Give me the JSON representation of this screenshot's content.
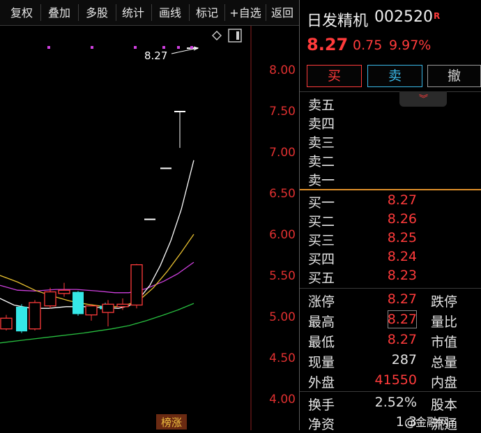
{
  "toolbar": {
    "items": [
      {
        "label": "复权"
      },
      {
        "label": "叠加"
      },
      {
        "label": "多股"
      },
      {
        "label": "统计"
      },
      {
        "label": "画线"
      },
      {
        "label": "标记"
      },
      {
        "label": "+自选"
      },
      {
        "label": "返回"
      }
    ]
  },
  "chart": {
    "price_ticks": [
      "8.00",
      "7.50",
      "7.00",
      "6.50",
      "6.00",
      "5.50",
      "5.00",
      "4.50",
      "4.00"
    ],
    "last_price_label": "8.27",
    "badge": "榜涨",
    "colors": {
      "up": "#ff3b3b",
      "down": "#35e6e6",
      "ma_white": "#ffffff",
      "ma_yellow": "#e8c030",
      "ma_magenta": "#d040e0",
      "ma_green": "#28c040"
    }
  },
  "chart_data": {
    "type": "candlestick",
    "y_axis_ticks": [
      8.0,
      7.5,
      7.0,
      6.5,
      6.0,
      5.5,
      5.0,
      4.5,
      4.0
    ],
    "ylim": [
      3.8,
      8.4
    ],
    "candles": [
      {
        "open": 4.85,
        "close": 4.98,
        "high": 5.02,
        "low": 4.83,
        "dir": "up"
      },
      {
        "open": 5.12,
        "close": 4.82,
        "high": 5.15,
        "low": 4.8,
        "dir": "down"
      },
      {
        "open": 4.85,
        "close": 5.17,
        "high": 5.2,
        "low": 4.83,
        "dir": "up"
      },
      {
        "open": 5.13,
        "close": 5.3,
        "high": 5.35,
        "low": 5.1,
        "dir": "up"
      },
      {
        "open": 5.32,
        "close": 5.28,
        "high": 5.41,
        "low": 5.24,
        "dir": "up"
      },
      {
        "open": 5.3,
        "close": 5.03,
        "high": 5.31,
        "low": 5.01,
        "dir": "down"
      },
      {
        "open": 5.02,
        "close": 5.13,
        "high": 5.15,
        "low": 4.95,
        "dir": "up"
      },
      {
        "open": 5.13,
        "close": 5.09,
        "high": 5.17,
        "low": 5.05,
        "dir": "down"
      },
      {
        "open": 5.05,
        "close": 5.15,
        "high": 5.2,
        "low": 4.88,
        "dir": "up"
      },
      {
        "open": 5.12,
        "close": 5.15,
        "high": 5.22,
        "low": 5.08,
        "dir": "up"
      },
      {
        "open": 5.14,
        "close": 5.63,
        "high": 5.64,
        "low": 5.1,
        "dir": "up"
      },
      {
        "open": 6.19,
        "close": 6.19,
        "high": 6.19,
        "low": 6.19,
        "dir": "up"
      },
      {
        "open": 6.81,
        "close": 6.81,
        "high": 6.81,
        "low": 6.81,
        "dir": "up"
      },
      {
        "open": 7.5,
        "close": 7.5,
        "high": 7.5,
        "low": 7.05,
        "dir": "up"
      },
      {
        "open": 8.27,
        "close": 8.27,
        "high": 8.27,
        "low": 8.27,
        "dir": "up"
      }
    ]
  },
  "quote": {
    "name": "日发精机",
    "code": "002520",
    "flag": "R",
    "price": "8.27",
    "change": "0.75",
    "change_pct": "9.97%"
  },
  "actions": {
    "buy": "买",
    "sell": "卖",
    "cancel": "撤"
  },
  "order_book": {
    "sell": [
      {
        "label": "卖五",
        "price": ""
      },
      {
        "label": "卖四",
        "price": ""
      },
      {
        "label": "卖三",
        "price": ""
      },
      {
        "label": "卖二",
        "price": ""
      },
      {
        "label": "卖一",
        "price": ""
      }
    ],
    "buy": [
      {
        "label": "买一",
        "price": "8.27"
      },
      {
        "label": "买二",
        "price": "8.26"
      },
      {
        "label": "买三",
        "price": "8.25"
      },
      {
        "label": "买四",
        "price": "8.24"
      },
      {
        "label": "买五",
        "price": "8.23"
      }
    ]
  },
  "stats": [
    {
      "label": "涨停",
      "value": "8.27",
      "label2": "跌停"
    },
    {
      "label": "最高",
      "value": "8.27",
      "label2": "量比"
    },
    {
      "label": "最低",
      "value": "8.27",
      "label2": "市值"
    },
    {
      "label": "现量",
      "value": "287",
      "label2": "总量"
    },
    {
      "label": "外盘",
      "value": "41550",
      "label2": "内盘"
    },
    {
      "label": "换手",
      "value": "2.52%",
      "label2": "股本"
    },
    {
      "label": "净资",
      "value": "1.3",
      "label2": "流通"
    }
  ],
  "watermark": "@金融网"
}
